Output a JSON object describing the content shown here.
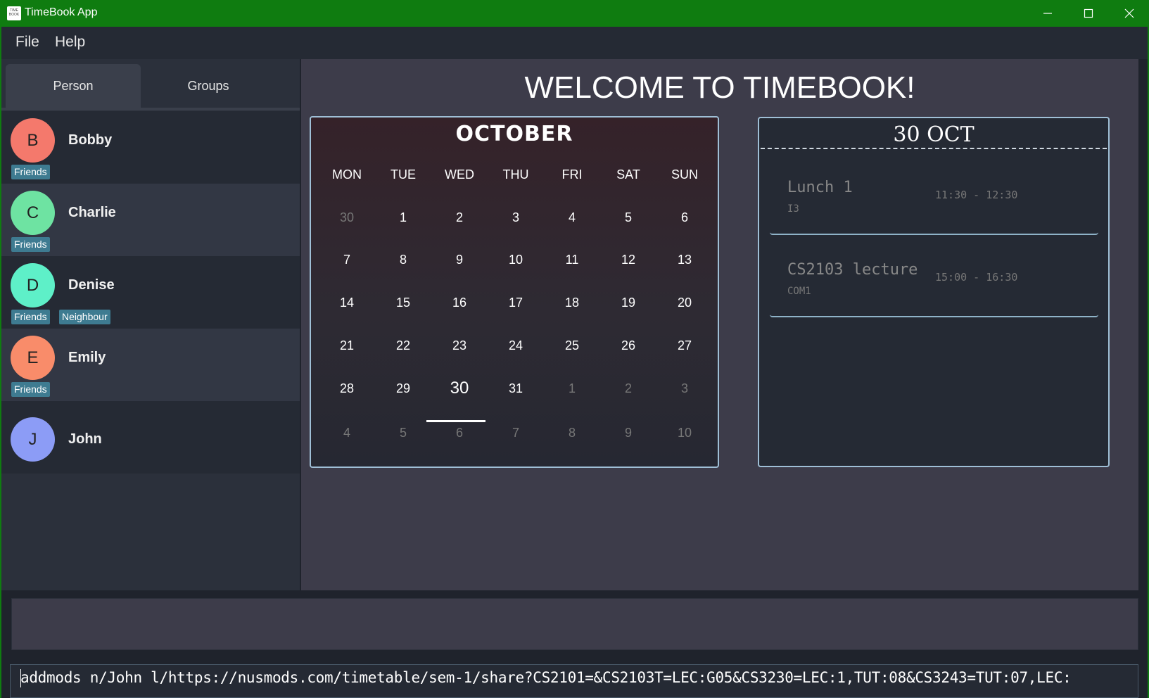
{
  "window": {
    "title": "TimeBook App",
    "icon_label": "TIME BOOK"
  },
  "menu": {
    "file": "File",
    "help": "Help"
  },
  "tabs": {
    "person": "Person",
    "groups": "Groups"
  },
  "persons": [
    {
      "initial": "B",
      "name": "Bobby",
      "color": "#f4796c",
      "tags": [
        "Friends"
      ]
    },
    {
      "initial": "C",
      "name": "Charlie",
      "color": "#6ee3a2",
      "tags": [
        "Friends"
      ]
    },
    {
      "initial": "D",
      "name": "Denise",
      "color": "#5ef0c8",
      "tags": [
        "Friends",
        "Neighbour"
      ]
    },
    {
      "initial": "E",
      "name": "Emily",
      "color": "#f98c6a",
      "tags": [
        "Friends"
      ]
    },
    {
      "initial": "J",
      "name": "John",
      "color": "#8c9cf6",
      "tags": []
    }
  ],
  "welcome": "WELCOME TO TIMEBOOK!",
  "calendar": {
    "month": "OCTOBER",
    "weekdays": [
      "MON",
      "TUE",
      "WED",
      "THU",
      "FRI",
      "SAT",
      "SUN"
    ],
    "weeks": [
      [
        "30",
        "1",
        "2",
        "3",
        "4",
        "5",
        "6"
      ],
      [
        "7",
        "8",
        "9",
        "10",
        "11",
        "12",
        "13"
      ],
      [
        "14",
        "15",
        "16",
        "17",
        "18",
        "19",
        "20"
      ],
      [
        "21",
        "22",
        "23",
        "24",
        "25",
        "26",
        "27"
      ],
      [
        "28",
        "29",
        "30",
        "31",
        "1",
        "2",
        "3"
      ],
      [
        "4",
        "5",
        "6",
        "7",
        "8",
        "9",
        "10"
      ]
    ],
    "selected_day": "30"
  },
  "schedule": {
    "date": "30 OCT",
    "events": [
      {
        "name": "Lunch 1",
        "location": "I3",
        "time": "11:30 - 12:30"
      },
      {
        "name": "CS2103 lecture",
        "location": "COM1",
        "time": "15:00 - 16:30"
      }
    ]
  },
  "result": {
    "text": ""
  },
  "command": {
    "value": "addmods n/John l/https://nusmods.com/timetable/sem-1/share?CS2101=&CS2103T=LEC:G05&CS3230=LEC:1,TUT:08&CS3243=TUT:07,LEC:"
  }
}
